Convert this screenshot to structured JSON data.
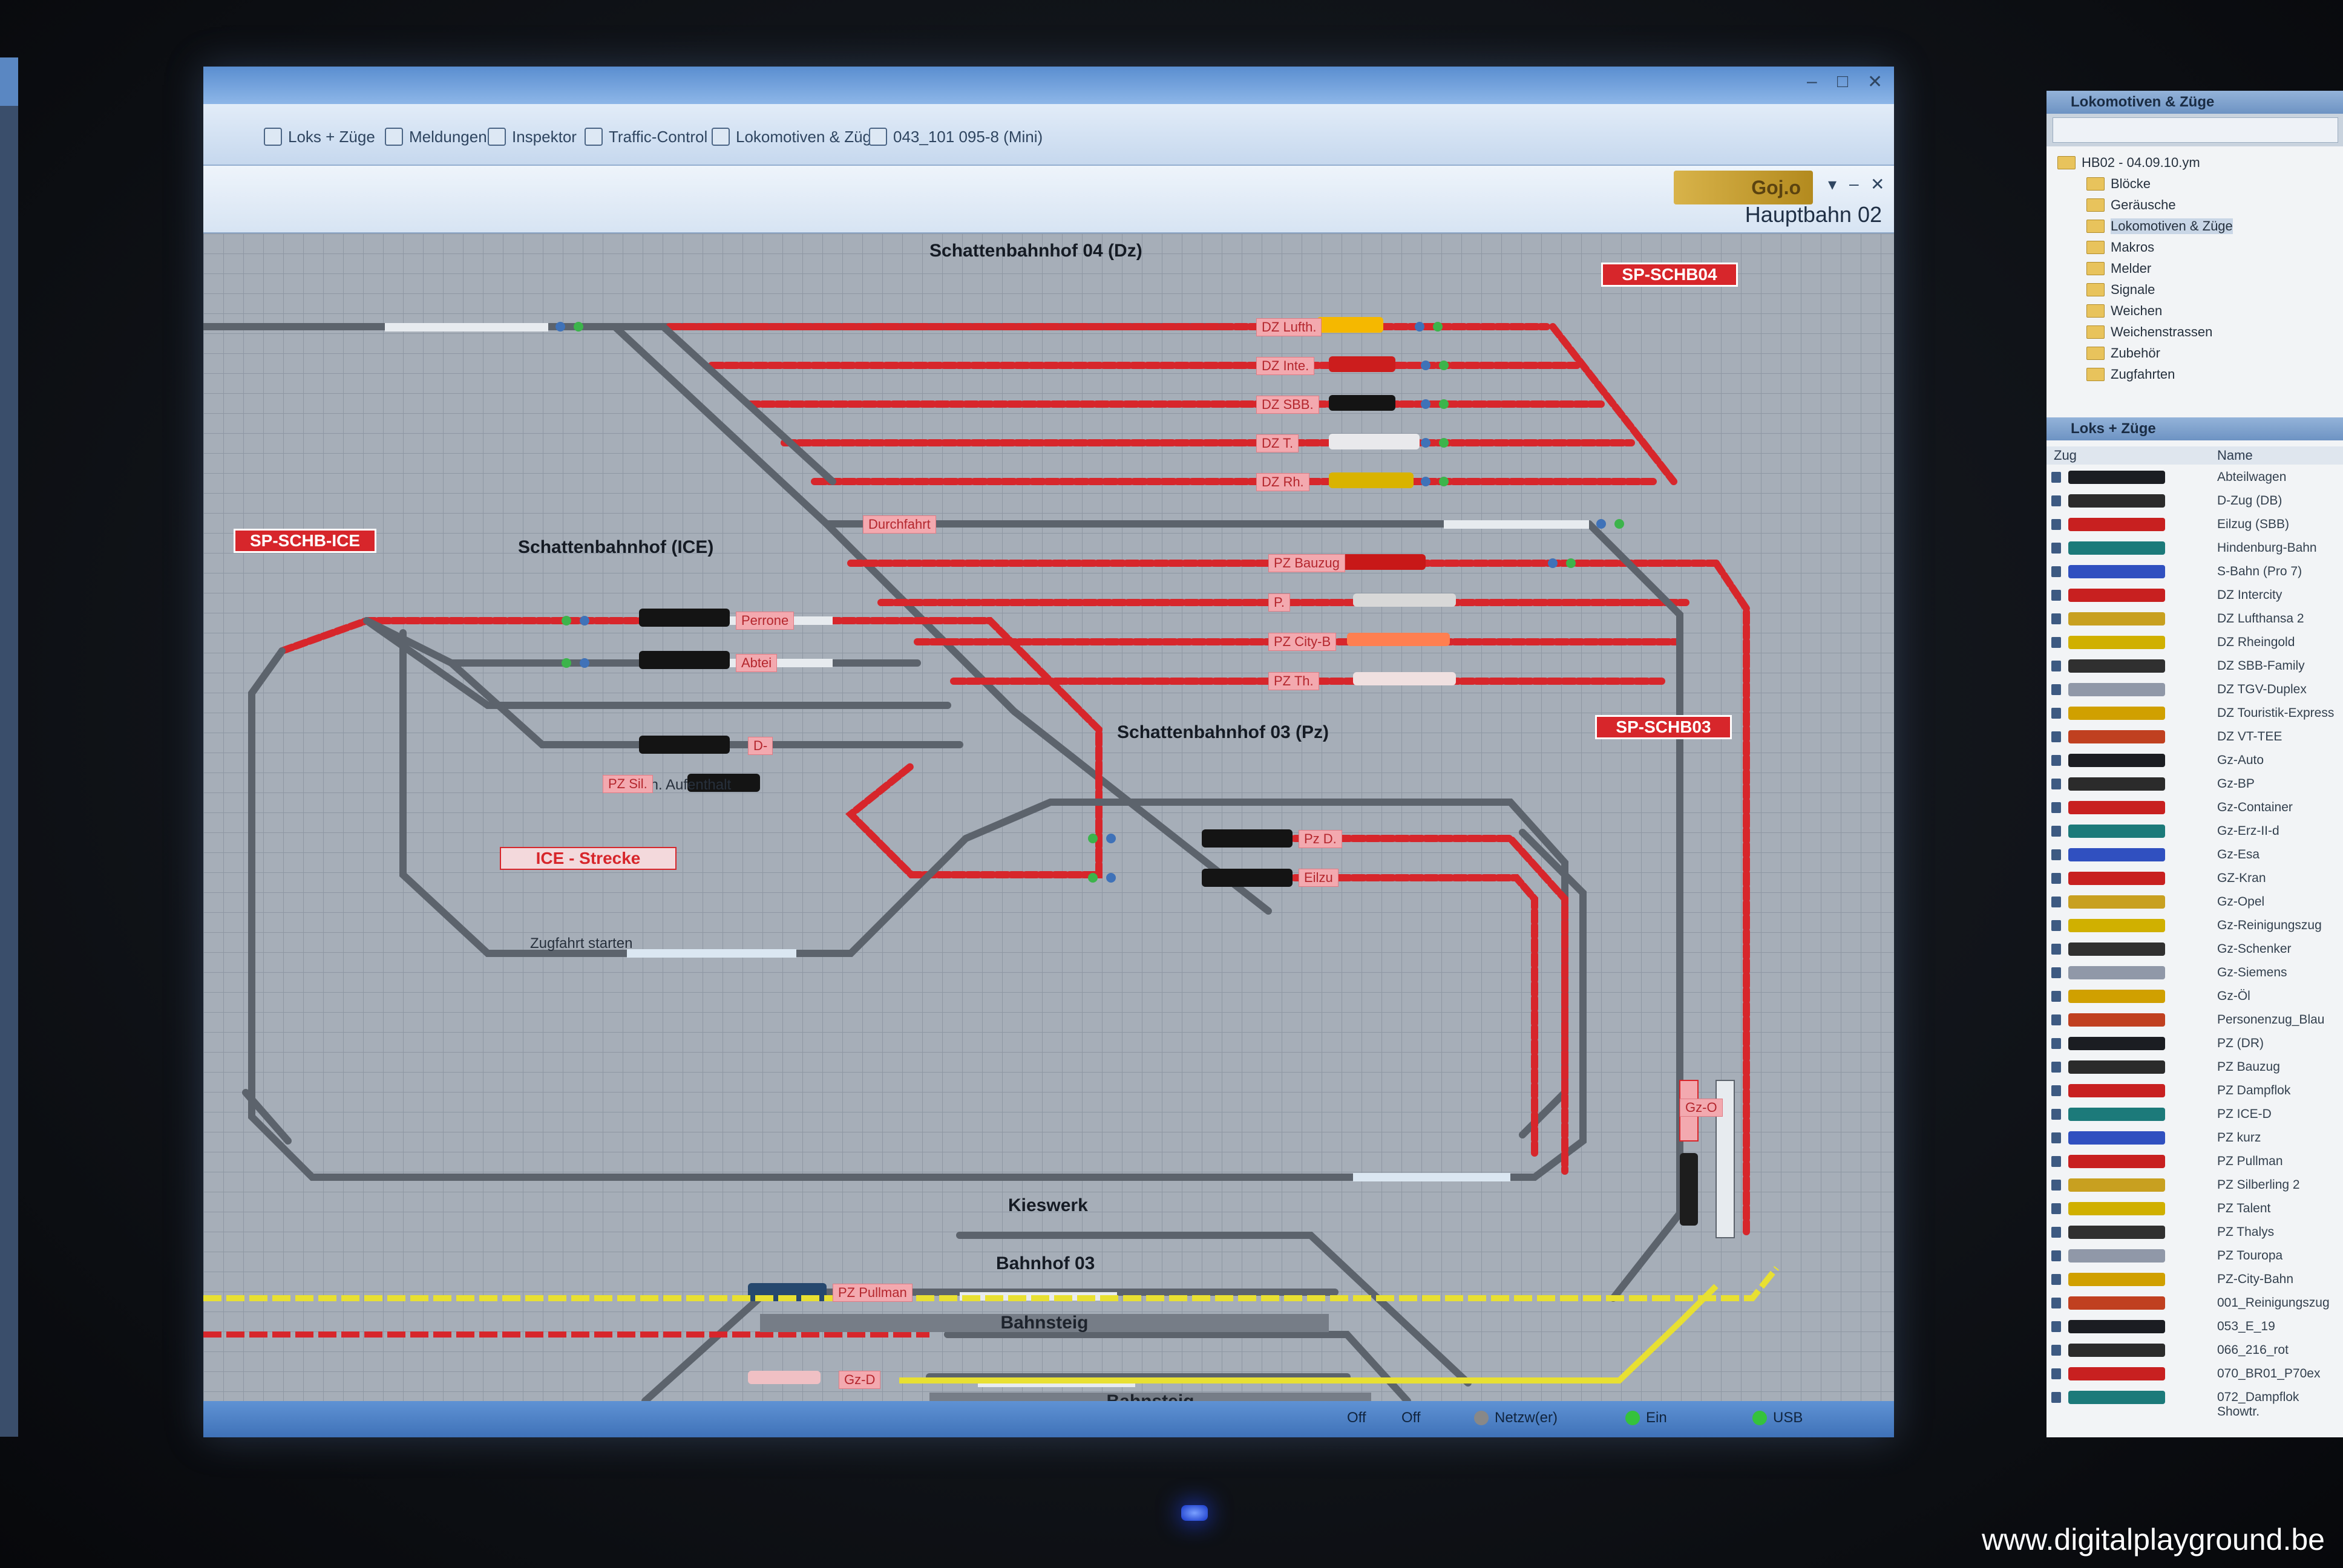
{
  "window": {
    "tabs": [
      "Loks + Züge",
      "Meldungen",
      "Inspektor",
      "Traffic-Control",
      "Lokomotiven & Züge",
      "043_101 095-8 (Mini)"
    ],
    "sheet_title": "Hauptbahn 02",
    "logo_text": "Goj.o"
  },
  "layout": {
    "station_labels": {
      "schb04": "Schattenbahnhof 04 (Dz)",
      "schb_ice": "Schattenbahnhof (ICE)",
      "schb03": "Schattenbahnhof 03 (Pz)",
      "kieswerk": "Kieswerk",
      "bahnhof03": "Bahnhof 03",
      "bahnsteig1": "Bahnsteig",
      "bahnsteig2": "Bahnsteig"
    },
    "red_tags": {
      "sp_schb04": "SP-SCHB04",
      "sp_schb_ice": "SP-SCHB-ICE",
      "sp_schb03": "SP-SCHB03"
    },
    "ice_strecke": "ICE - Strecke",
    "notes": {
      "aufenthalt": "1min. Aufenthalt",
      "zugfahrt": "Zugfahrt starten"
    },
    "train_labels": {
      "dz_lufth": "DZ Lufth.",
      "dz_inte": "DZ Inte.",
      "dz_sbb": "DZ SBB.",
      "dz_t": "DZ T.",
      "dz_rh": "DZ Rh.",
      "durchfahrt": "Durchfahrt",
      "pz_bauzug": "PZ Bauzug",
      "p": "P.",
      "pz_city": "PZ City-B",
      "pz_th": "PZ Th.",
      "perrone": "Perrone",
      "abtei": "Abtei",
      "d": "D-",
      "pz_sil": "PZ Sil.",
      "pz_d": "Pz D.",
      "eilzu": "Eilzu",
      "pz_pullman": "PZ Pullman",
      "gz_d": "Gz-D",
      "gz_o": "Gz-O"
    }
  },
  "status": {
    "items": [
      "Off",
      "Off",
      "Netzw(er)",
      "Ein",
      "USB"
    ]
  },
  "right_panel": {
    "title": "Lokomotiven & Züge",
    "dropdown": "",
    "tree": [
      "HB02 - 04.09.10.ym",
      "Blöcke",
      "Geräusche",
      "Lokomotiven & Züge",
      "Makros",
      "Melder",
      "Signale",
      "Weichen",
      "Weichenstrassen",
      "Zubehör",
      "Zugfahrten"
    ],
    "list_title": "Loks + Züge",
    "columns": [
      "Zug",
      "Name"
    ],
    "rows": [
      "Abteilwagen",
      "D-Zug (DB)",
      "Eilzug (SBB)",
      "Hindenburg-Bahn",
      "S-Bahn (Pro 7)",
      "DZ Intercity",
      "DZ Lufthansa 2",
      "DZ Rheingold",
      "DZ SBB-Family",
      "DZ TGV-Duplex",
      "DZ Touristik-Express",
      "DZ VT-TEE",
      "Gz-Auto",
      "Gz-BP",
      "Gz-Container",
      "Gz-Erz-II-d",
      "Gz-Esa",
      "GZ-Kran",
      "Gz-Opel",
      "Gz-Reinigungszug",
      "Gz-Schenker",
      "Gz-Siemens",
      "Gz-Öl",
      "Personenzug_Blau",
      "PZ (DR)",
      "PZ Bauzug",
      "PZ Dampflok",
      "PZ ICE-D",
      "PZ kurz",
      "PZ Pullman",
      "PZ Silberling 2",
      "PZ Talent",
      "PZ Thalys",
      "PZ Touropa",
      "PZ-City-Bahn",
      "001_Reinigungszug",
      "053_E_19",
      "066_216_rot",
      "070_BR01_P70ex",
      "072_Dampflok Showtr."
    ]
  },
  "watermark": "www.digitalplayground.be",
  "colors": {
    "track_red": "#d7262b",
    "track_gray": "#5c636c",
    "track_yellow": "#e8e032",
    "accent_blue": "#3f72b8"
  }
}
